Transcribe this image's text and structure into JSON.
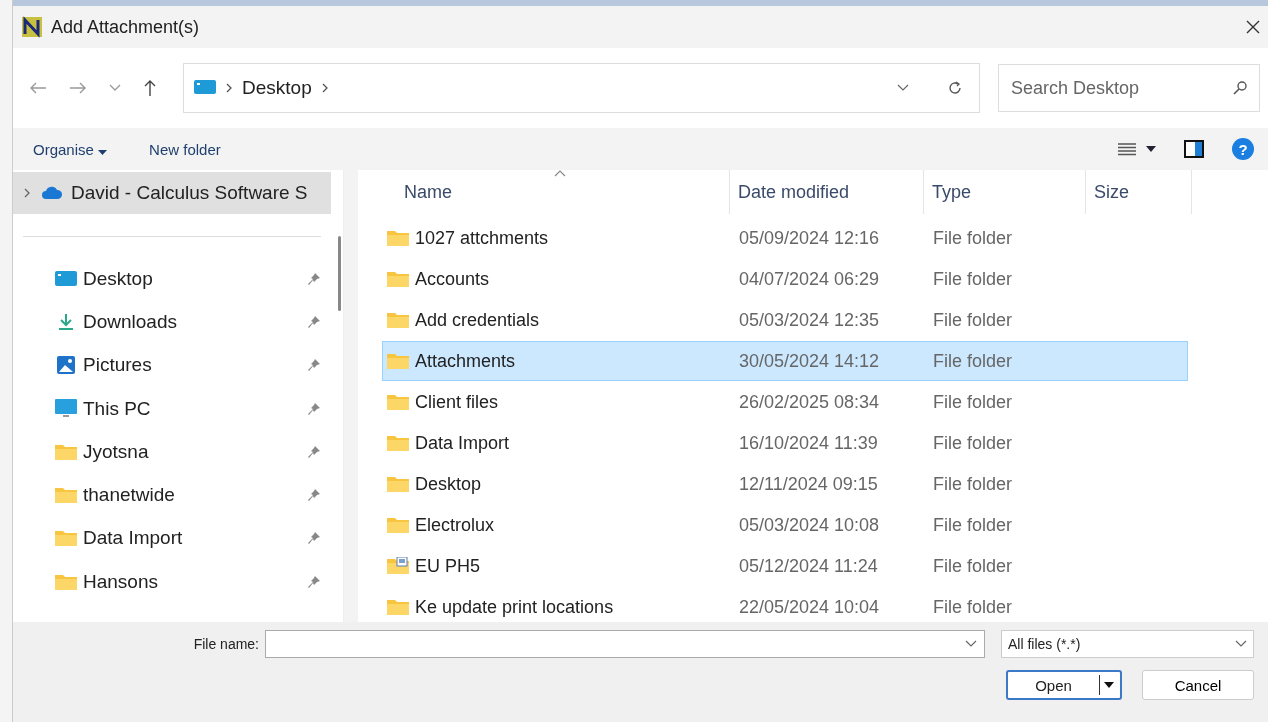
{
  "window": {
    "title": "Add Attachment(s)"
  },
  "address": {
    "crumbs": [
      "Desktop"
    ]
  },
  "search": {
    "placeholder": "Search Desktop"
  },
  "toolbar": {
    "organise": "Organise",
    "new_folder": "New folder",
    "help": "?"
  },
  "sidebar": {
    "top_item": {
      "label": "David - Calculus Software S",
      "selected": true
    },
    "items": [
      {
        "label": "Desktop",
        "kind": "desktop"
      },
      {
        "label": "Downloads",
        "kind": "download"
      },
      {
        "label": "Pictures",
        "kind": "pictures"
      },
      {
        "label": "This PC",
        "kind": "pc"
      },
      {
        "label": "Jyotsna",
        "kind": "folder"
      },
      {
        "label": "thanetwide",
        "kind": "folder"
      },
      {
        "label": "Data Import",
        "kind": "folder"
      },
      {
        "label": "Hansons",
        "kind": "folder"
      }
    ]
  },
  "table": {
    "columns": [
      "Name",
      "Date modified",
      "Type",
      "Size"
    ],
    "rows": [
      {
        "name": "1027 attchments",
        "date": "05/09/2024 12:16",
        "type": "File folder",
        "kind": "folder",
        "selected": false
      },
      {
        "name": "Accounts",
        "date": "04/07/2024 06:29",
        "type": "File folder",
        "kind": "folder",
        "selected": false
      },
      {
        "name": "Add credentials",
        "date": "05/03/2024 12:35",
        "type": "File folder",
        "kind": "folder",
        "selected": false
      },
      {
        "name": "Attachments",
        "date": "30/05/2024 14:12",
        "type": "File folder",
        "kind": "folder",
        "selected": true
      },
      {
        "name": "Client files",
        "date": "26/02/2025 08:34",
        "type": "File folder",
        "kind": "folder",
        "selected": false
      },
      {
        "name": "Data Import",
        "date": "16/10/2024 11:39",
        "type": "File folder",
        "kind": "folder",
        "selected": false
      },
      {
        "name": "Desktop",
        "date": "12/11/2024 09:15",
        "type": "File folder",
        "kind": "folder",
        "selected": false
      },
      {
        "name": "Electrolux",
        "date": "05/03/2024 10:08",
        "type": "File folder",
        "kind": "folder",
        "selected": false
      },
      {
        "name": "EU PH5",
        "date": "05/12/2024 11:24",
        "type": "File folder",
        "kind": "special",
        "selected": false
      },
      {
        "name": "Ke update print locations",
        "date": "22/05/2024 10:04",
        "type": "File folder",
        "kind": "folder",
        "selected": false
      }
    ]
  },
  "footer": {
    "file_name_label": "File name:",
    "file_type": "All files (*.*)",
    "open": "Open",
    "cancel": "Cancel"
  }
}
